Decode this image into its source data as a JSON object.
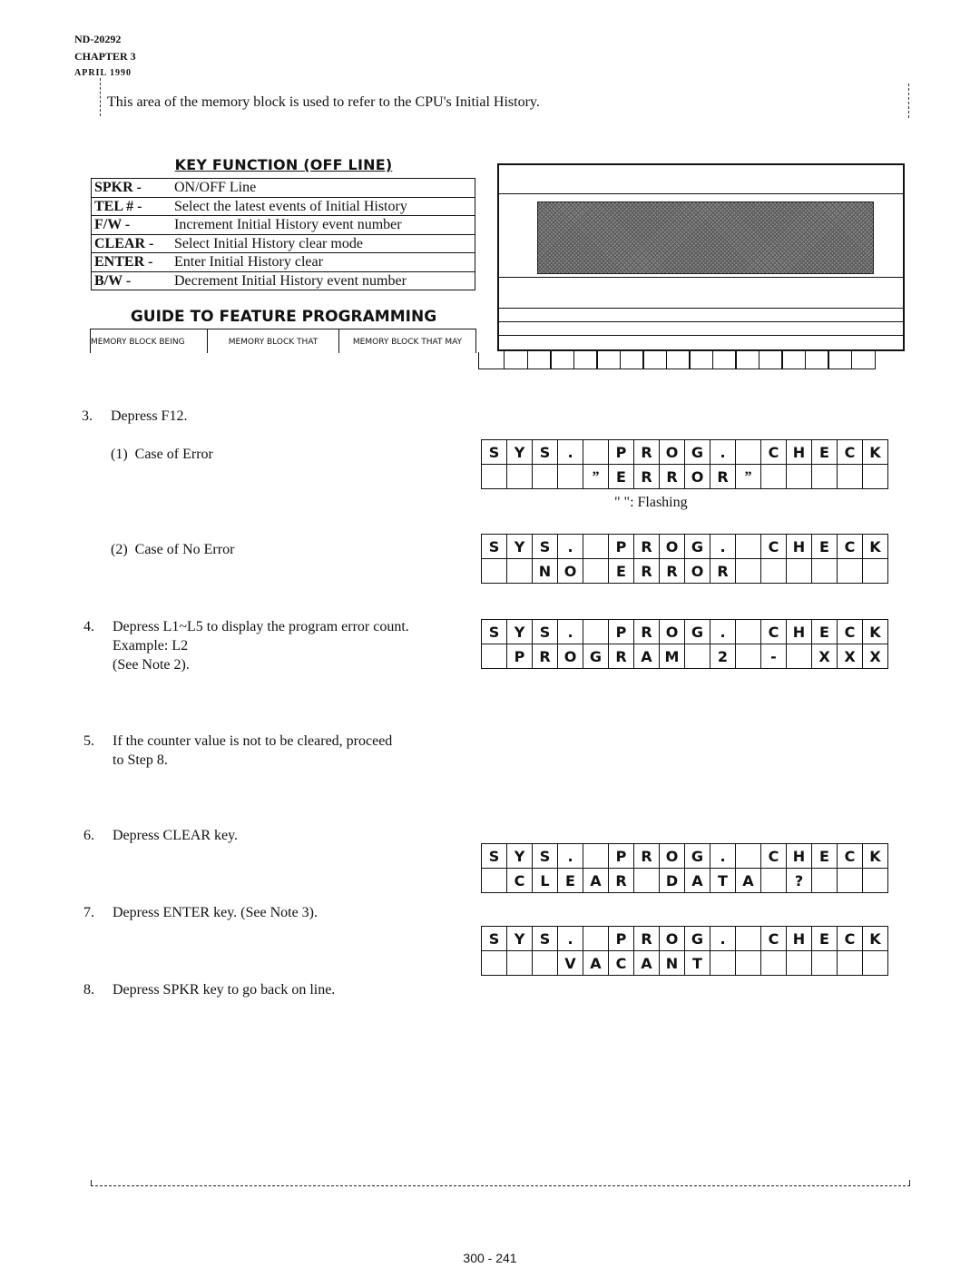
{
  "header": {
    "doc_number": "ND-20292",
    "chapter": "CHAPTER 3",
    "date": "APRIL 1990"
  },
  "intro_text": "This area of the memory block is used to refer to the  CPU's Initial History.",
  "key_function": {
    "title": "KEY FUNCTION (OFF LINE)",
    "rows": [
      {
        "key": "SPKR -",
        "desc": "ON/OFF Line"
      },
      {
        "key": "TEL # -",
        "desc": "Select the latest events of  Initial History"
      },
      {
        "key": "F/W  -",
        "desc": "Increment Initial History event number"
      },
      {
        "key": "CLEAR -",
        "desc": "Select Initial History clear mode"
      },
      {
        "key": "ENTER -",
        "desc": "Enter Initial History clear"
      },
      {
        "key": "B/W  -",
        "desc": "Decrement Initial History event number"
      }
    ]
  },
  "guide": {
    "title": "GUIDE TO FEATURE PROGRAMMING",
    "columns": [
      "MEMORY BLOCK BEING",
      "MEMORY BLOCK THAT",
      "MEMORY BLOCK THAT MAY"
    ]
  },
  "steps": [
    {
      "num": "3.",
      "text": "Depress F12."
    },
    {
      "num": "(1)",
      "text": "Case of Error"
    },
    {
      "num": "(2)",
      "text": "Case of No Error"
    },
    {
      "num": "4.",
      "text": "Depress L1~L5 to display the program error count.",
      "line2": "Example:    L2",
      "line3": "(See Note 2)."
    },
    {
      "num": "5.",
      "text": "If the counter value is not to be cleared, proceed",
      "line2": "to Step 8."
    },
    {
      "num": "6.",
      "text": "Depress CLEAR key."
    },
    {
      "num": "7.",
      "text": "Depress ENTER key.  (See Note 3)."
    },
    {
      "num": "8.",
      "text": "Depress SPKR key to go back on line."
    }
  ],
  "displays": [
    {
      "name": "case-of-error",
      "row1": "SYS. PROG. CHECK",
      "row2": "    \"ERROR\"     "
    },
    {
      "name": "case-of-no-error",
      "row1": "SYS. PROG. CHECK",
      "row2": "  NO ERROR      "
    },
    {
      "name": "program-error-count",
      "row1": "SYS. PROG. CHECK",
      "row2": " PROGRAM 2 - XXX"
    },
    {
      "name": "clear-data",
      "row1": "SYS. PROG. CHECK",
      "row2": " CLEAR DATA ?   "
    },
    {
      "name": "vacant",
      "row1": "SYS. PROG. CHECK",
      "row2": "   VACANT       "
    }
  ],
  "flashing_note": "\"    \":  Flashing",
  "page_number": "300 - 241"
}
